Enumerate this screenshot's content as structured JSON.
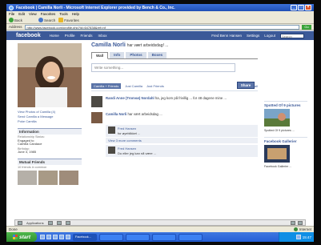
{
  "window": {
    "title": "Facebook | Camilla Norli - Microsoft Internet Explorer provided by Bench & Co., Inc."
  },
  "menu": [
    "File",
    "Edit",
    "View",
    "Favorites",
    "Tools",
    "Help"
  ],
  "toolbar": {
    "back": "Back",
    "search": "Search",
    "favorites": "Favorites"
  },
  "address": {
    "label": "Address",
    "url": "http://www.facebook.com/profile.php?id=647838&ref=nf",
    "go": "Go"
  },
  "facebook": {
    "logo": "facebook",
    "nav": [
      "Home",
      "Profile",
      "Friends",
      "Inbox"
    ],
    "right_nav": [
      "Fred Benn Hansen",
      "Settings",
      "Logout"
    ],
    "search_placeholder": "Search"
  },
  "profile": {
    "name": "Camilla Norli",
    "status": "har vært arbeidsdag! ...",
    "subline": "",
    "tabs": [
      "Wall",
      "Info",
      "Photos",
      "Boxes"
    ],
    "composer_placeholder": "Write something...",
    "share": "Share",
    "filters": [
      "Camilla + Friends",
      "Just Camilla",
      "Just Friends"
    ],
    "settings_link": "Wall-to-Wall"
  },
  "left": {
    "links": [
      "View Photos of Camilla (4)",
      "Send Camilla a Message",
      "Poke Camilla"
    ],
    "info_header": "Information",
    "info": [
      {
        "label": "Relationship Status:",
        "value": "Engaged to"
      },
      {
        "label": "",
        "value": "Camilla Candace"
      },
      {
        "label": "Birthday:",
        "value": "June 3, 1985"
      }
    ],
    "mutual_header": "Mutual Friends",
    "mutual_sub": "10 friends in common"
  },
  "posts": [
    {
      "who": "Randi Anne (Tromsø) Nordahl",
      "text": "ha, jeg kom på frivillig ... for 48 dagene mine ...",
      "meta": ""
    },
    {
      "who": "Camilla Norli",
      "text": "har vært arbeidsdag ...",
      "meta": ""
    }
  ],
  "comments": [
    {
      "who": "Fred Hansen",
      "text": "for øyeblikket ..."
    },
    {
      "who": "Fred Hansen",
      "text": "Du eller jeg kan nå være ..."
    }
  ],
  "view_all": "View 3 more comments",
  "right": {
    "ads": [
      {
        "title": "Spotted Of 9 pictures",
        "text": "Spotted Of 9 pictures ..."
      },
      {
        "title": "Facebook Gallerier",
        "text": "Facebook Gallerier ..."
      }
    ]
  },
  "chatbar": {
    "applications": "Applications"
  },
  "status": {
    "text": "Done",
    "zone": "Internet"
  },
  "taskbar": {
    "start": "start",
    "tasks": [
      "Facebook...",
      "",
      "",
      "",
      ""
    ],
    "time": "15:47"
  },
  "colors": {
    "fb_blue": "#3b5998",
    "xp_blue": "#245ed7",
    "start_green": "#3a9d37"
  }
}
